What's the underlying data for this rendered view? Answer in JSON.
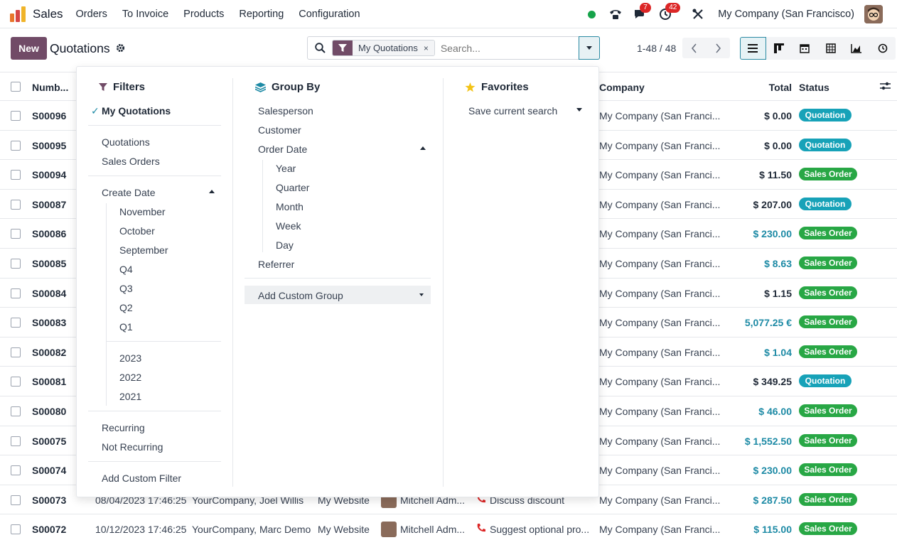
{
  "navbar": {
    "app_name": "Sales",
    "menu": [
      "Orders",
      "To Invoice",
      "Products",
      "Reporting",
      "Configuration"
    ],
    "messages_count": "7",
    "activities_count": "42",
    "company": "My Company (San Francisco)"
  },
  "control_panel": {
    "new_label": "New",
    "breadcrumb": "Quotations",
    "facet_label": "My Quotations",
    "facet_remove": "×",
    "search_placeholder": "Search...",
    "pager": "1-48 / 48"
  },
  "table": {
    "headers": {
      "number": "Numb...",
      "company": "Company",
      "total": "Total",
      "status": "Status"
    },
    "rows": [
      {
        "number": "S00096",
        "company": "My Company (San Franci...",
        "total": "$ 0.00",
        "status": "Quotation",
        "highlight": false
      },
      {
        "number": "S00095",
        "company": "My Company (San Franci...",
        "total": "$ 0.00",
        "status": "Quotation",
        "highlight": false
      },
      {
        "number": "S00094",
        "company": "My Company (San Franci...",
        "total": "$ 11.50",
        "status": "Sales Order",
        "highlight": false
      },
      {
        "number": "S00087",
        "company": "My Company (San Franci...",
        "total": "$ 207.00",
        "status": "Quotation",
        "highlight": false
      },
      {
        "number": "S00086",
        "company": "My Company (San Franci...",
        "total": "$ 230.00",
        "status": "Sales Order",
        "highlight": true
      },
      {
        "number": "S00085",
        "company": "My Company (San Franci...",
        "total": "$ 8.63",
        "status": "Sales Order",
        "highlight": true
      },
      {
        "number": "S00084",
        "company": "My Company (San Franci...",
        "total": "$ 1.15",
        "status": "Sales Order",
        "highlight": false
      },
      {
        "number": "S00083",
        "company": "My Company (San Franci...",
        "total": "5,077.25 €",
        "status": "Sales Order",
        "highlight": true
      },
      {
        "number": "S00082",
        "company": "My Company (San Franci...",
        "total": "$ 1.04",
        "status": "Sales Order",
        "highlight": true
      },
      {
        "number": "S00081",
        "company": "My Company (San Franci...",
        "total": "$ 349.25",
        "status": "Quotation",
        "highlight": false
      },
      {
        "number": "S00080",
        "company": "My Company (San Franci...",
        "total": "$ 46.00",
        "status": "Sales Order",
        "highlight": true
      },
      {
        "number": "S00075",
        "company": "My Company (San Franci...",
        "total": "$ 1,552.50",
        "status": "Sales Order",
        "highlight": true
      },
      {
        "number": "S00074",
        "company": "My Company (San Franci...",
        "total": "$ 230.00",
        "status": "Sales Order",
        "highlight": true
      },
      {
        "number": "S00073",
        "date": "08/04/2023 17:46:25",
        "customer": "YourCompany, Joel Willis",
        "source": "My Website",
        "salesperson": "Mitchell Adm...",
        "activity": "Discuss discount",
        "company": "My Company (San Franci...",
        "total": "$ 287.50",
        "status": "Sales Order",
        "highlight": true
      },
      {
        "number": "S00072",
        "date": "10/12/2023 17:46:25",
        "customer": "YourCompany, Marc Demo",
        "source": "My Website",
        "salesperson": "Mitchell Adm...",
        "activity": "Suggest optional pro...",
        "company": "My Company (San Franci...",
        "total": "$ 115.00",
        "status": "Sales Order",
        "highlight": true
      }
    ]
  },
  "dropdown": {
    "filters": {
      "title": "Filters",
      "checked": "My Quotations",
      "group1": [
        "Quotations",
        "Sales Orders"
      ],
      "create_date": "Create Date",
      "date_options": [
        "November",
        "October",
        "September",
        "Q4",
        "Q3",
        "Q2",
        "Q1"
      ],
      "years": [
        "2023",
        "2022",
        "2021"
      ],
      "group3": [
        "Recurring",
        "Not Recurring"
      ],
      "add_custom": "Add Custom Filter"
    },
    "group_by": {
      "title": "Group By",
      "items_top": [
        "Salesperson",
        "Customer"
      ],
      "order_date": "Order Date",
      "date_options": [
        "Year",
        "Quarter",
        "Month",
        "Week",
        "Day"
      ],
      "referrer": "Referrer",
      "add_custom": "Add Custom Group"
    },
    "favorites": {
      "title": "Favorites",
      "save_search": "Save current search"
    }
  },
  "colors": {
    "brand": "#714b67",
    "teal": "#1d8aa5",
    "quotation": "#17a2b8",
    "sales_order": "#28a745",
    "star": "#f3c316"
  }
}
